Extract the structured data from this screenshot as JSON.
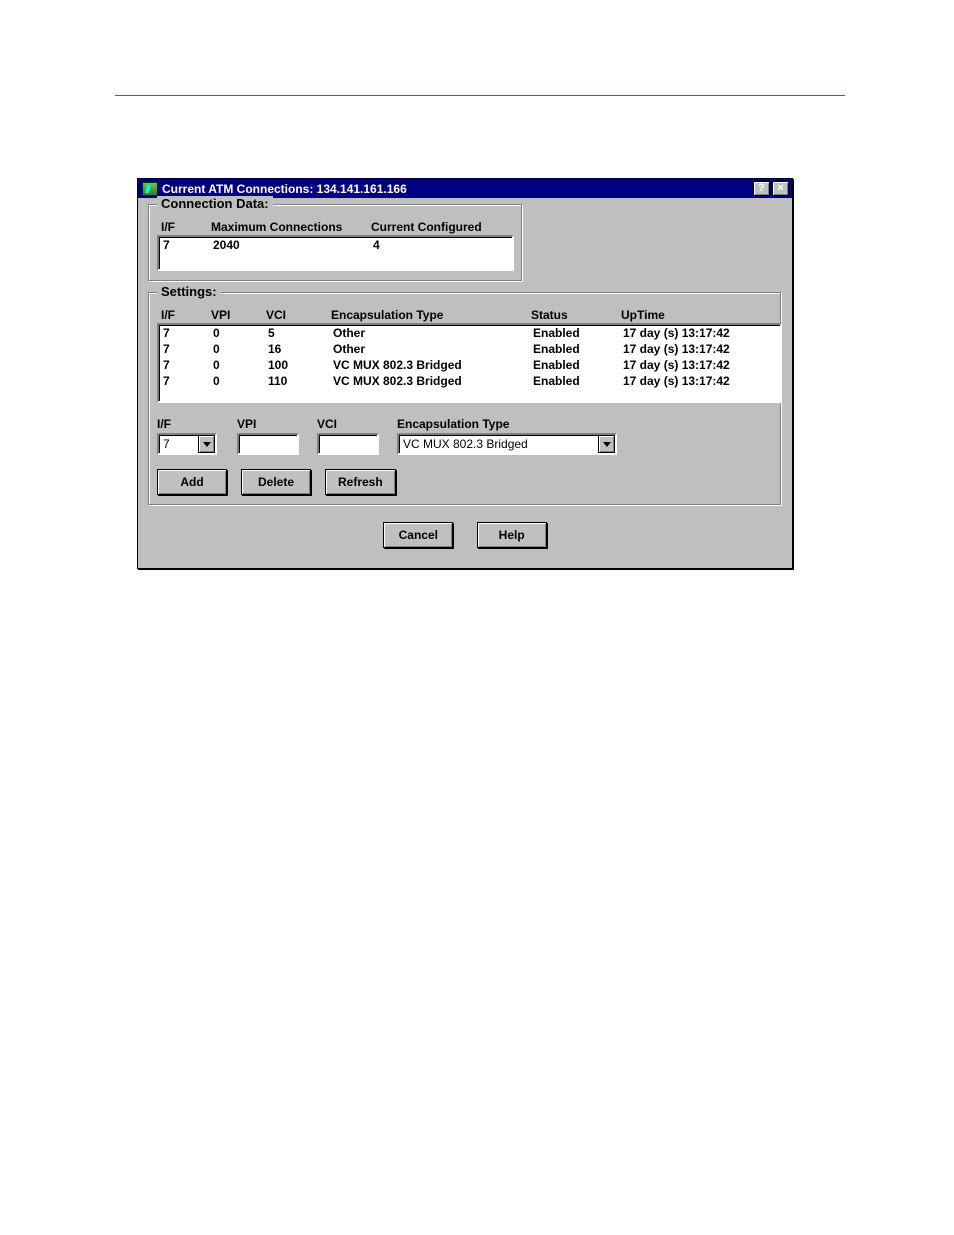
{
  "titlebar": {
    "title": "Current ATM Connections: 134.141.161.166",
    "help_glyph": "?",
    "close_glyph": "×"
  },
  "group_conn": {
    "legend": "Connection Data:",
    "headers": {
      "if": "I/F",
      "max": "Maximum Connections",
      "curr": "Current Configured"
    },
    "row": {
      "if": "7",
      "max": "2040",
      "curr": "4"
    }
  },
  "group_sett": {
    "legend": "Settings:",
    "headers": {
      "if": "I/F",
      "vpi": "VPI",
      "vci": "VCI",
      "enc": "Encapsulation Type",
      "status": "Status",
      "uptime": "UpTime"
    },
    "rows": [
      {
        "if": "7",
        "vpi": "0",
        "vci": "5",
        "enc": "Other",
        "status": "Enabled",
        "uptime": "17 day (s) 13:17:42"
      },
      {
        "if": "7",
        "vpi": "0",
        "vci": "16",
        "enc": "Other",
        "status": "Enabled",
        "uptime": "17 day (s) 13:17:42"
      },
      {
        "if": "7",
        "vpi": "0",
        "vci": "100",
        "enc": "VC MUX 802.3 Bridged",
        "status": "Enabled",
        "uptime": "17 day (s) 13:17:42"
      },
      {
        "if": "7",
        "vpi": "0",
        "vci": "110",
        "enc": "VC MUX 802.3 Bridged",
        "status": "Enabled",
        "uptime": "17 day (s) 13:17:42"
      }
    ],
    "edit": {
      "labels": {
        "if": "I/F",
        "vpi": "VPI",
        "vci": "VCI",
        "enc": "Encapsulation Type"
      },
      "values": {
        "if": "7",
        "vpi": "",
        "vci": "",
        "enc": "VC MUX 802.3 Bridged"
      }
    },
    "buttons": {
      "add": "Add",
      "delete": "Delete",
      "refresh": "Refresh"
    }
  },
  "dialog_buttons": {
    "cancel": "Cancel",
    "help": "Help"
  }
}
